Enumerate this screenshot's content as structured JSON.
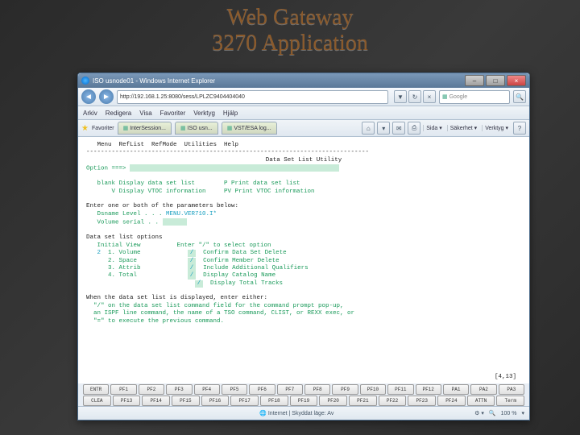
{
  "slide": {
    "line1": "Web Gateway",
    "line2": "3270 Application"
  },
  "window": {
    "title": "ISO usnode01 - Windows Internet Explorer"
  },
  "nav": {
    "url": "http://192.168.1.25:8080/sess/LPLZC9404404040"
  },
  "search": {
    "placeholder": "Google"
  },
  "menu": {
    "items": [
      "Arkiv",
      "Redigera",
      "Visa",
      "Favoriter",
      "Verktyg",
      "Hjälp"
    ]
  },
  "fav": {
    "label": "Favoriter"
  },
  "tabs": [
    {
      "label": "InterSession..."
    },
    {
      "label": "ISO usn..."
    },
    {
      "label": "VST/ESA log..."
    }
  ],
  "toolbar_right": [
    "Sida ▾",
    "Säkerhet ▾",
    "Verktyg ▾"
  ],
  "term": {
    "menu": "   Menu  RefList  RefMode  Utilities  Help",
    "dash1": "------------------------------------------------------------------------------",
    "title": "Data Set List Utility",
    "option_label": "Option ===>",
    "modes": {
      "l1": "   blank Display data set list        P Print data set list",
      "l2": "       V Display VTOC information     PV Print VTOC information"
    },
    "params_head": "Enter one or both of the parameters below:",
    "dsname_label": "   Dsname Level . . .",
    "dsname_value": "MENU.VER710.I*",
    "volser_label": "   Volume serial . .",
    "list_head": "Data set list options",
    "init_view": "   Initial View          Enter \"/\" to select option",
    "init_val": "2",
    "views": [
      "1. Volume",
      "2. Space",
      "3. Attrib",
      "4. Total"
    ],
    "opts": [
      "Confirm Data Set Delete",
      "Confirm Member Delete",
      "Include Additional Qualifiers",
      "Display Catalog Name",
      "Display Total Tracks"
    ],
    "foot1": "When the data set list is displayed, enter either:",
    "foot2": "  \"/\" on the data set list command field for the command prompt pop-up,",
    "foot3": "  an ISPF line command, the name of a TSO command, CLIST, or REXX exec, or",
    "foot4": "  \"=\" to execute the previous command.",
    "cursor": "[4,13]"
  },
  "pfkeys_row1": [
    "ENTR",
    "PF1",
    "PF2",
    "PF3",
    "PF4",
    "PF5",
    "PF6",
    "PF7",
    "PF8",
    "PF9",
    "PF10",
    "PF11",
    "PF12",
    "PA1",
    "PA2",
    "PA3"
  ],
  "pfkeys_row2": [
    "CLEA",
    "PF13",
    "PF14",
    "PF15",
    "PF16",
    "PF17",
    "PF18",
    "PF19",
    "PF20",
    "PF21",
    "PF22",
    "PF23",
    "PF24",
    "ATTN",
    "Term"
  ],
  "status": {
    "zone": "Internet | Skyddat läge: Av",
    "zoom": "100 %"
  }
}
